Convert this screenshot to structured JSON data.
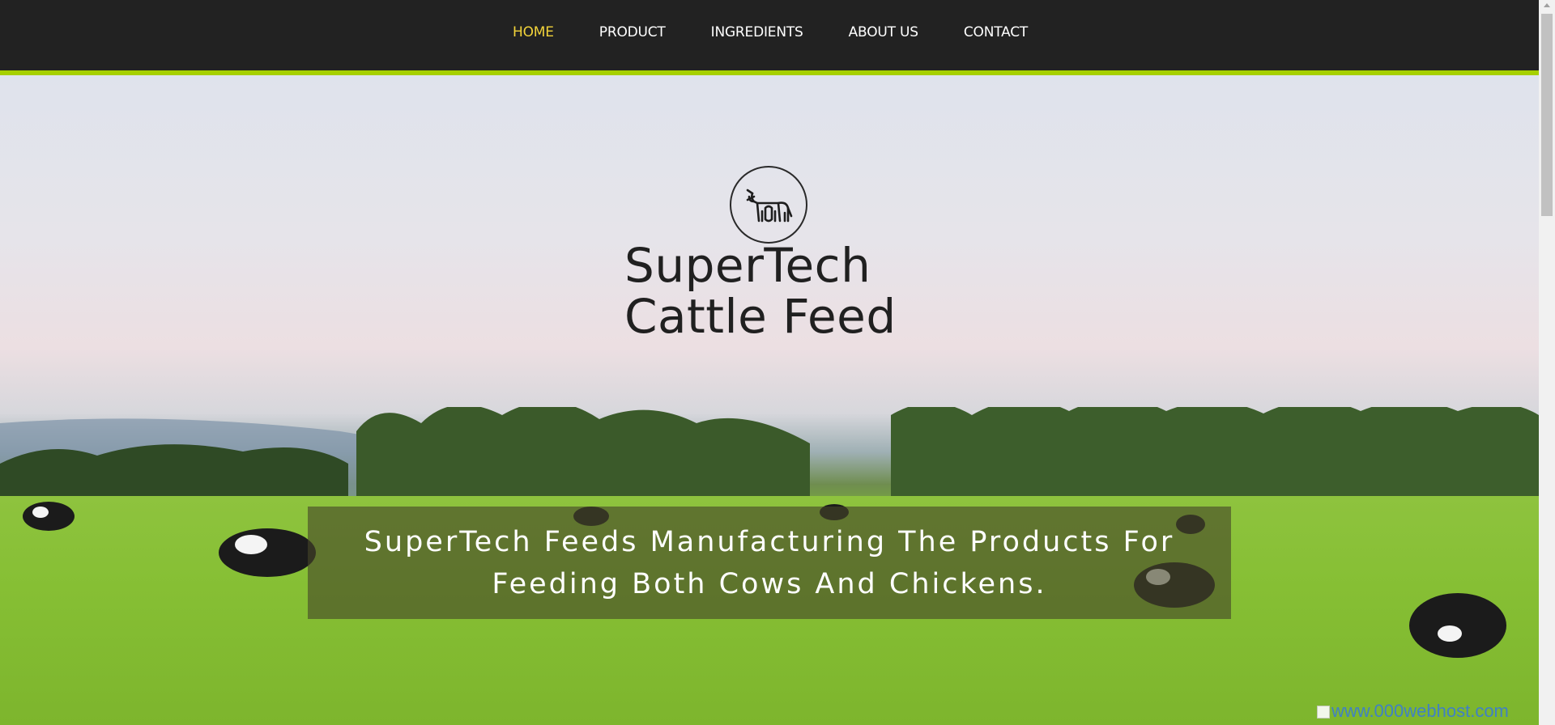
{
  "nav": {
    "items": [
      {
        "label": "HOME",
        "active": true
      },
      {
        "label": "PRODUCT",
        "active": false
      },
      {
        "label": "INGREDIENTS",
        "active": false
      },
      {
        "label": "ABOUT US",
        "active": false
      },
      {
        "label": "CONTACT",
        "active": false
      }
    ],
    "active_color": "#f2d33a",
    "accent_color": "#a6d000"
  },
  "hero": {
    "logo_icon": "cow-icon",
    "title_line1": "SuperTech",
    "title_line2": "Cattle Feed",
    "tagline_line1": "SuperTech Feeds Manufacturing The Products For",
    "tagline_line2": "Feeding Both Cows And Chickens."
  },
  "watermark": {
    "text": "www.000webhost.com"
  }
}
